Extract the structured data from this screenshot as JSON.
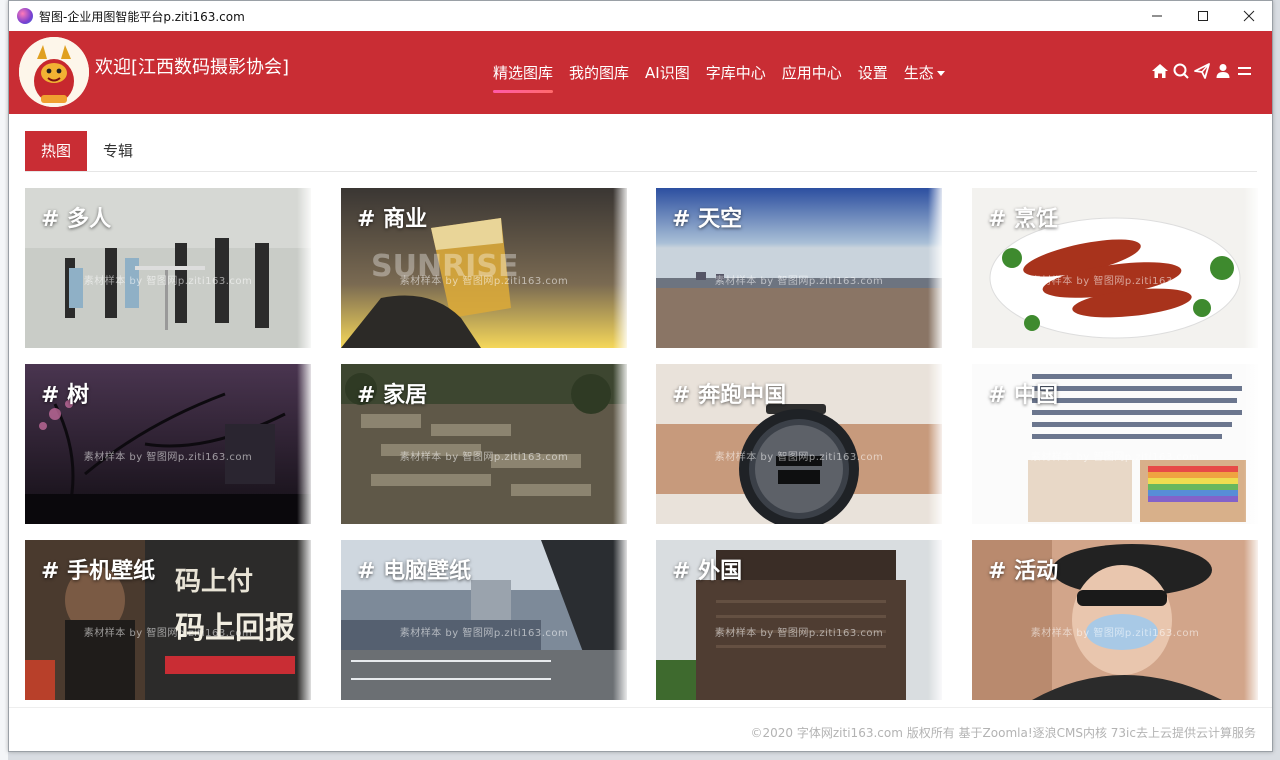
{
  "window": {
    "title": "智图-企业用图智能平台p.ziti163.com",
    "controls": {
      "minimize": "—",
      "maximize": "☐",
      "close": "✕"
    }
  },
  "header": {
    "welcome": "欢迎[江西数码摄影协会]",
    "nav": [
      {
        "label": "精选图库",
        "active": true
      },
      {
        "label": "我的图库"
      },
      {
        "label": "AI识图"
      },
      {
        "label": "字库中心"
      },
      {
        "label": "应用中心"
      },
      {
        "label": "设置"
      },
      {
        "label": "生态",
        "dropdown": true
      }
    ],
    "icons": [
      "home-icon",
      "search-icon",
      "send-icon",
      "user-icon",
      "menu-icon"
    ]
  },
  "tabs": [
    {
      "label": "热图",
      "active": true
    },
    {
      "label": "专辑"
    }
  ],
  "tiles": [
    {
      "label": "# 多人",
      "watermark": "素材样本 by 智图网p.ziti163.com"
    },
    {
      "label": "# 商业",
      "watermark": "素材样本 by 智图网p.ziti163.com"
    },
    {
      "label": "# 天空",
      "watermark": "素材样本 by 智图网p.ziti163.com"
    },
    {
      "label": "# 烹饪",
      "watermark": "素材样本 by 智图网p.ziti163.com"
    },
    {
      "label": "# 树",
      "watermark": "素材样本 by 智图网p.ziti163.com"
    },
    {
      "label": "# 家居",
      "watermark": "素材样本 by 智图网p.ziti163.com"
    },
    {
      "label": "# 奔跑中国",
      "watermark": "素材样本 by 智图网p.ziti163.com"
    },
    {
      "label": "# 中国",
      "watermark": "素材样本 by 智图网p.ziti163.com"
    },
    {
      "label": "# 手机壁纸",
      "watermark": "素材样本 by 智图网p.ziti163.com"
    },
    {
      "label": "# 电脑壁纸",
      "watermark": "素材样本 by 智图网p.ziti163.com"
    },
    {
      "label": "# 外国",
      "watermark": "素材样本 by 智图网p.ziti163.com"
    },
    {
      "label": "# 活动",
      "watermark": "素材样本 by 智图网p.ziti163.com"
    }
  ],
  "footer": {
    "text": "©2020 字体网ziti163.com 版权所有 基于Zoomla!逐浪CMS内核 73ic去上云提供云计算服务"
  },
  "colors": {
    "brand": "#c92d34",
    "nav_underline": "#ff5aa8"
  }
}
